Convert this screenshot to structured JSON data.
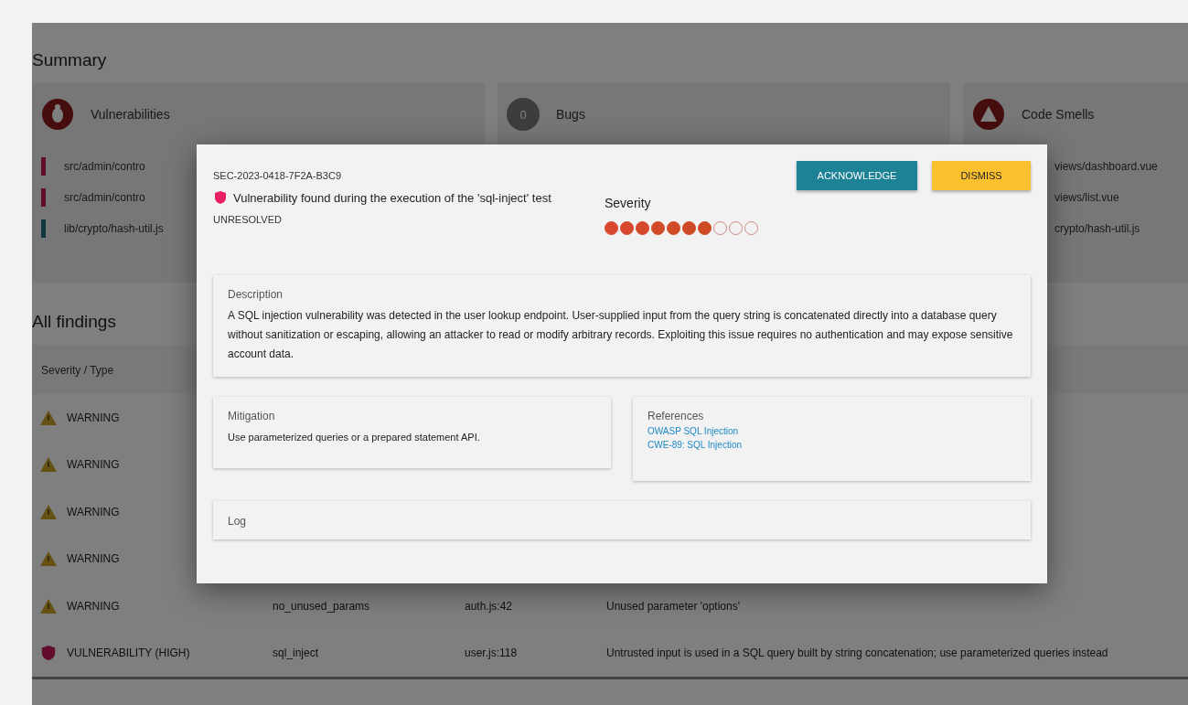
{
  "summary": {
    "title": "Summary",
    "cards": [
      {
        "title": "Vulnerabilities",
        "kind": "bug",
        "rows": [
          {
            "text": "src/admin/contro",
            "kind": "critical"
          },
          {
            "text": "src/admin/contro",
            "kind": "critical"
          },
          {
            "text": "lib/crypto/hash-util.js",
            "kind": "minor"
          }
        ]
      },
      {
        "title": "Bugs",
        "kind": "count",
        "badge": "0"
      },
      {
        "title": "Code Smells",
        "kind": "alert",
        "rows": [
          {
            "text": "views/dashboard.vue"
          },
          {
            "text": "views/list.vue"
          },
          {
            "text": "crypto/hash-util.js"
          }
        ]
      }
    ]
  },
  "findings": {
    "title": "All findings",
    "column_1": "Severity / Type",
    "rows": [
      {
        "kind": "warning",
        "type": "WARNING"
      },
      {
        "kind": "warning",
        "type": "WARNING"
      },
      {
        "kind": "warning",
        "type": "WARNING"
      },
      {
        "kind": "warning",
        "type": "WARNING"
      },
      {
        "kind": "warning",
        "type": "WARNING",
        "rule": "no_unused_params",
        "file": "auth.js:42",
        "message": "Unused parameter 'options'"
      },
      {
        "kind": "vulnerability",
        "type": "VULNERABILITY (HIGH)",
        "rule": "sql_inject",
        "file": "user.js:118",
        "message": "Untrusted input is used in a SQL query built by string concatenation; use parameterized queries instead"
      }
    ]
  },
  "dialog": {
    "id": "SEC-2023-0418-7F2A-B3C9",
    "title": "Vulnerability found during the execution of the 'sql-inject' test",
    "status": "UNRESOLVED",
    "severity_label": "Severity",
    "stars": 7,
    "buttons": [
      {
        "label": "ACKNOWLEDGE",
        "kind": "primary"
      },
      {
        "label": "DISMISS",
        "kind": "warning"
      }
    ],
    "description": {
      "title": "Description",
      "text": "A SQL injection vulnerability was detected in the user lookup endpoint. User-supplied input from the query string is concatenated directly into a database query without sanitization or escaping, allowing an attacker to read or modify arbitrary records. Exploiting this issue requires no authentication and may expose sensitive account data."
    },
    "mitigation": {
      "title": "Mitigation",
      "text": "Use parameterized queries or a prepared statement API."
    },
    "references": {
      "title": "References",
      "links": [
        "OWASP SQL Injection",
        "CWE-89: SQL Injection"
      ]
    },
    "log": {
      "title": "Log"
    }
  }
}
